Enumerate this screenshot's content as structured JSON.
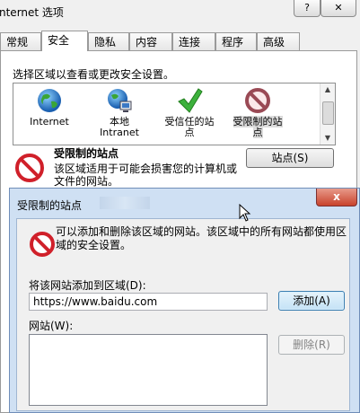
{
  "window": {
    "title": "nternet 选项",
    "help_icon": "question-icon",
    "close_icon": "close-icon"
  },
  "tabs": [
    {
      "label": "常规"
    },
    {
      "label": "安全",
      "active": true
    },
    {
      "label": "隐私"
    },
    {
      "label": "内容"
    },
    {
      "label": "连接"
    },
    {
      "label": "程序"
    },
    {
      "label": "高级"
    }
  ],
  "security": {
    "prompt": "选择区域以查看或更改安全设置。",
    "zones": [
      {
        "label": "Internet",
        "icon": "globe-icon"
      },
      {
        "label": "本地\nIntranet",
        "icon": "intranet-icon"
      },
      {
        "label": "受信任的站\n点",
        "icon": "checkmark-icon"
      },
      {
        "label": "受限制的站\n点",
        "icon": "no-entry-icon",
        "selected": true
      }
    ],
    "zone_title": "受限制的站点",
    "zone_description": "该区域适用于可能会损害您的计算机或文件的网站。",
    "sites_button": "站点(S)"
  },
  "dialog": {
    "title": "受限制的站点",
    "close_label": "x",
    "info": "可以添加和删除该区域的网站。该区域中的所有网站都使用区域的安全设置。",
    "add_label": "将该网站添加到区域(D):",
    "url_value": "https://www.baidu.com",
    "add_button": "添加(A)",
    "sites_label": "网站(W):",
    "remove_button": "删除(R)"
  },
  "colors": {
    "no_entry_red": "#d0202a",
    "dialog_frame": "#cfe0f3",
    "add_button_border": "#3c7fb1"
  }
}
